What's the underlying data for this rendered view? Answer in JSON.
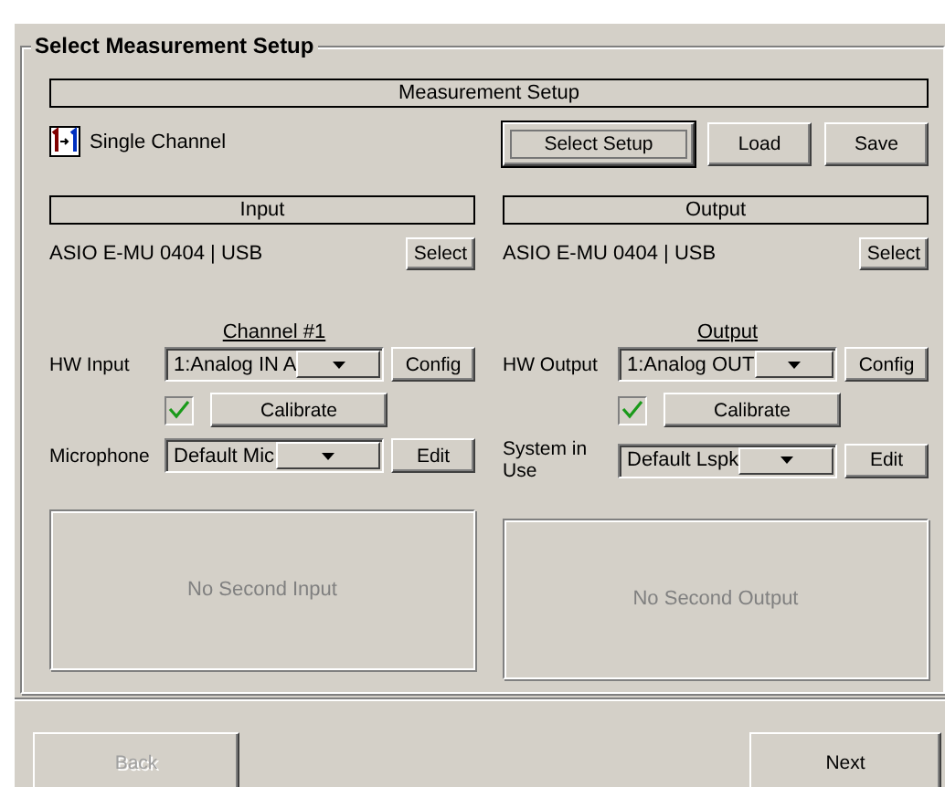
{
  "group_title": "Select Measurement Setup",
  "measurement_setup": {
    "header": "Measurement Setup",
    "mode_label": "Single Channel",
    "buttons": [
      {
        "label": "Select Setup",
        "focused": true
      },
      {
        "label": "Load",
        "focused": false
      },
      {
        "label": "Save",
        "focused": false
      }
    ]
  },
  "columns": [
    {
      "header": "Input",
      "device": "ASIO E-MU 0404 | USB",
      "select_button": "Select",
      "channel_title": "Channel #1",
      "hw_label": "HW Input",
      "hw_value": "1:Analog IN A",
      "config_button": "Config",
      "calibrate_checked": true,
      "calibrate_button": "Calibrate",
      "system_label": "Microphone",
      "system_value": "Default Mic",
      "edit_button": "Edit",
      "empty_panel_text": "No Second Input"
    },
    {
      "header": "Output",
      "device": "ASIO E-MU 0404 | USB",
      "select_button": "Select",
      "channel_title": "Output",
      "hw_label": "HW Output",
      "hw_value": "1:Analog OUT",
      "config_button": "Config",
      "calibrate_checked": true,
      "calibrate_button": "Calibrate",
      "system_label": "System in Use",
      "system_value": "Default Lspk",
      "edit_button": "Edit",
      "empty_panel_text": "No Second Output"
    }
  ],
  "nav": [
    {
      "label": "Back",
      "disabled": true
    },
    {
      "label": "Next",
      "disabled": false
    }
  ]
}
